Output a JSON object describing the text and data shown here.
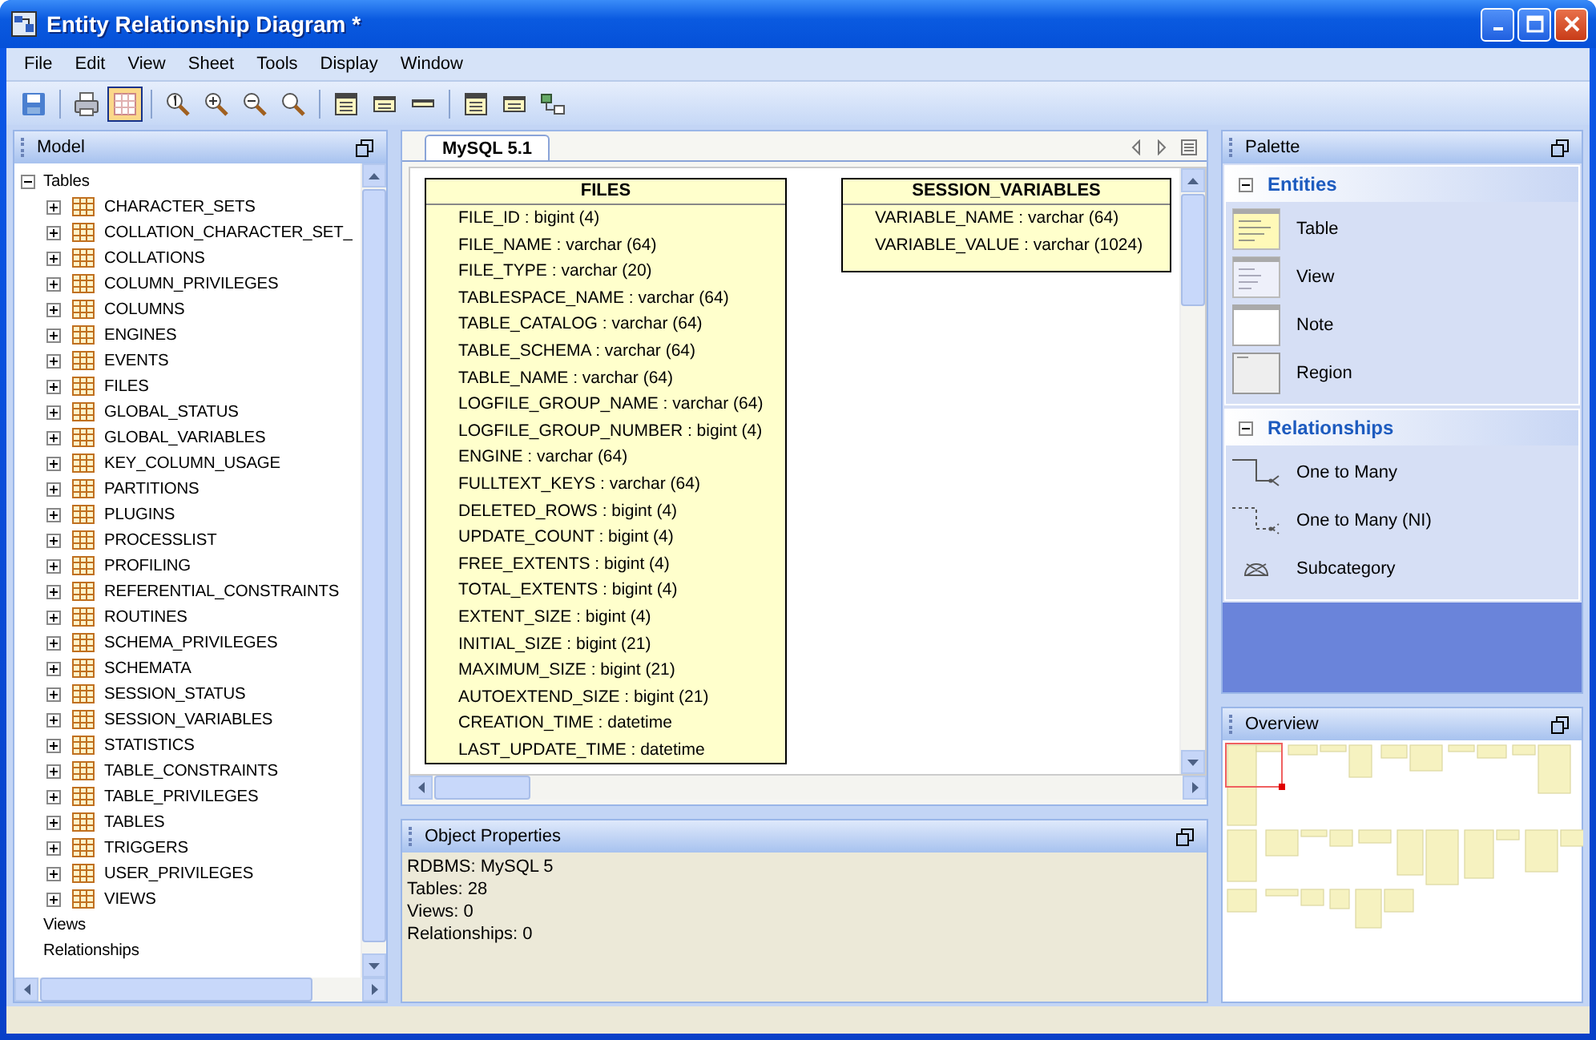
{
  "window": {
    "title": "Entity Relationship Diagram *"
  },
  "menu": [
    "File",
    "Edit",
    "View",
    "Sheet",
    "Tools",
    "Display",
    "Window"
  ],
  "toolbar": [
    {
      "kind": "save",
      "selected": false
    },
    {
      "kind": "sep"
    },
    {
      "kind": "print",
      "selected": false
    },
    {
      "kind": "grid",
      "selected": true
    },
    {
      "kind": "sep"
    },
    {
      "kind": "zoom-actual",
      "selected": false
    },
    {
      "kind": "zoom-in",
      "selected": false
    },
    {
      "kind": "zoom-out",
      "selected": false
    },
    {
      "kind": "zoom-fit",
      "selected": false
    },
    {
      "kind": "sep"
    },
    {
      "kind": "table-full",
      "selected": false
    },
    {
      "kind": "table-keys",
      "selected": false
    },
    {
      "kind": "table-name",
      "selected": false
    },
    {
      "kind": "sep"
    },
    {
      "kind": "table-full",
      "selected": false
    },
    {
      "kind": "table-keys",
      "selected": false
    },
    {
      "kind": "layout",
      "selected": false
    }
  ],
  "model": {
    "title": "Model",
    "tree": [
      {
        "label": "Tables",
        "kind": "group",
        "expanded": true,
        "children": [
          {
            "label": "CHARACTER_SETS",
            "expanded": false
          },
          {
            "label": "COLLATION_CHARACTER_SET_",
            "expanded": false
          },
          {
            "label": "COLLATIONS",
            "expanded": false
          },
          {
            "label": "COLUMN_PRIVILEGES",
            "expanded": false
          },
          {
            "label": "COLUMNS",
            "expanded": false
          },
          {
            "label": "ENGINES",
            "expanded": false
          },
          {
            "label": "EVENTS",
            "expanded": false
          },
          {
            "label": "FILES",
            "expanded": false
          },
          {
            "label": "GLOBAL_STATUS",
            "expanded": false
          },
          {
            "label": "GLOBAL_VARIABLES",
            "expanded": false
          },
          {
            "label": "KEY_COLUMN_USAGE",
            "expanded": false
          },
          {
            "label": "PARTITIONS",
            "expanded": false
          },
          {
            "label": "PLUGINS",
            "expanded": false
          },
          {
            "label": "PROCESSLIST",
            "expanded": false
          },
          {
            "label": "PROFILING",
            "expanded": false
          },
          {
            "label": "REFERENTIAL_CONSTRAINTS",
            "expanded": false
          },
          {
            "label": "ROUTINES",
            "expanded": false
          },
          {
            "label": "SCHEMA_PRIVILEGES",
            "expanded": false
          },
          {
            "label": "SCHEMATA",
            "expanded": false
          },
          {
            "label": "SESSION_STATUS",
            "expanded": false
          },
          {
            "label": "SESSION_VARIABLES",
            "expanded": false
          },
          {
            "label": "STATISTICS",
            "expanded": false
          },
          {
            "label": "TABLE_CONSTRAINTS",
            "expanded": false
          },
          {
            "label": "TABLE_PRIVILEGES",
            "expanded": false
          },
          {
            "label": "TABLES",
            "expanded": false
          },
          {
            "label": "TRIGGERS",
            "expanded": false
          },
          {
            "label": "USER_PRIVILEGES",
            "expanded": false
          },
          {
            "label": "VIEWS",
            "expanded": false
          }
        ]
      },
      {
        "label": "Views",
        "kind": "leaf"
      },
      {
        "label": "Relationships",
        "kind": "leaf"
      }
    ]
  },
  "sheet": {
    "tabs": [
      {
        "label": "MySQL 5.1",
        "selected": true
      }
    ],
    "entities": [
      {
        "name": "FILES",
        "columns": [
          "FILE_ID : bigint (4)",
          "FILE_NAME : varchar (64)",
          "FILE_TYPE : varchar (20)",
          "TABLESPACE_NAME : varchar (64)",
          "TABLE_CATALOG : varchar (64)",
          "TABLE_SCHEMA : varchar (64)",
          "TABLE_NAME : varchar (64)",
          "LOGFILE_GROUP_NAME : varchar (64)",
          "LOGFILE_GROUP_NUMBER : bigint (4)",
          "ENGINE : varchar (64)",
          "FULLTEXT_KEYS : varchar (64)",
          "DELETED_ROWS : bigint (4)",
          "UPDATE_COUNT : bigint (4)",
          "FREE_EXTENTS : bigint (4)",
          "TOTAL_EXTENTS : bigint (4)",
          "EXTENT_SIZE : bigint (4)",
          "INITIAL_SIZE : bigint (21)",
          "MAXIMUM_SIZE : bigint (21)",
          "AUTOEXTEND_SIZE : bigint (21)",
          "CREATION_TIME : datetime",
          "LAST_UPDATE_TIME : datetime"
        ]
      },
      {
        "name": "SESSION_VARIABLES",
        "columns": [
          "VARIABLE_NAME : varchar (64)",
          "VARIABLE_VALUE : varchar (1024)"
        ]
      }
    ]
  },
  "object_properties": {
    "title": "Object Properties",
    "lines": [
      "RDBMS: MySQL 5",
      "Tables: 28",
      "Views: 0",
      "Relationships: 0"
    ]
  },
  "palette": {
    "title": "Palette",
    "sections": [
      {
        "title": "Entities",
        "expanded": true,
        "items": [
          {
            "label": "Table",
            "kind": "table"
          },
          {
            "label": "View",
            "kind": "view"
          },
          {
            "label": "Note",
            "kind": "note"
          },
          {
            "label": "Region",
            "kind": "region"
          }
        ]
      },
      {
        "title": "Relationships",
        "expanded": true,
        "items": [
          {
            "label": "One to Many",
            "kind": "one-to-many"
          },
          {
            "label": "One to Many (NI)",
            "kind": "one-to-many-ni"
          },
          {
            "label": "Subcategory",
            "kind": "subcategory"
          }
        ]
      }
    ]
  },
  "overview": {
    "title": "Overview"
  }
}
